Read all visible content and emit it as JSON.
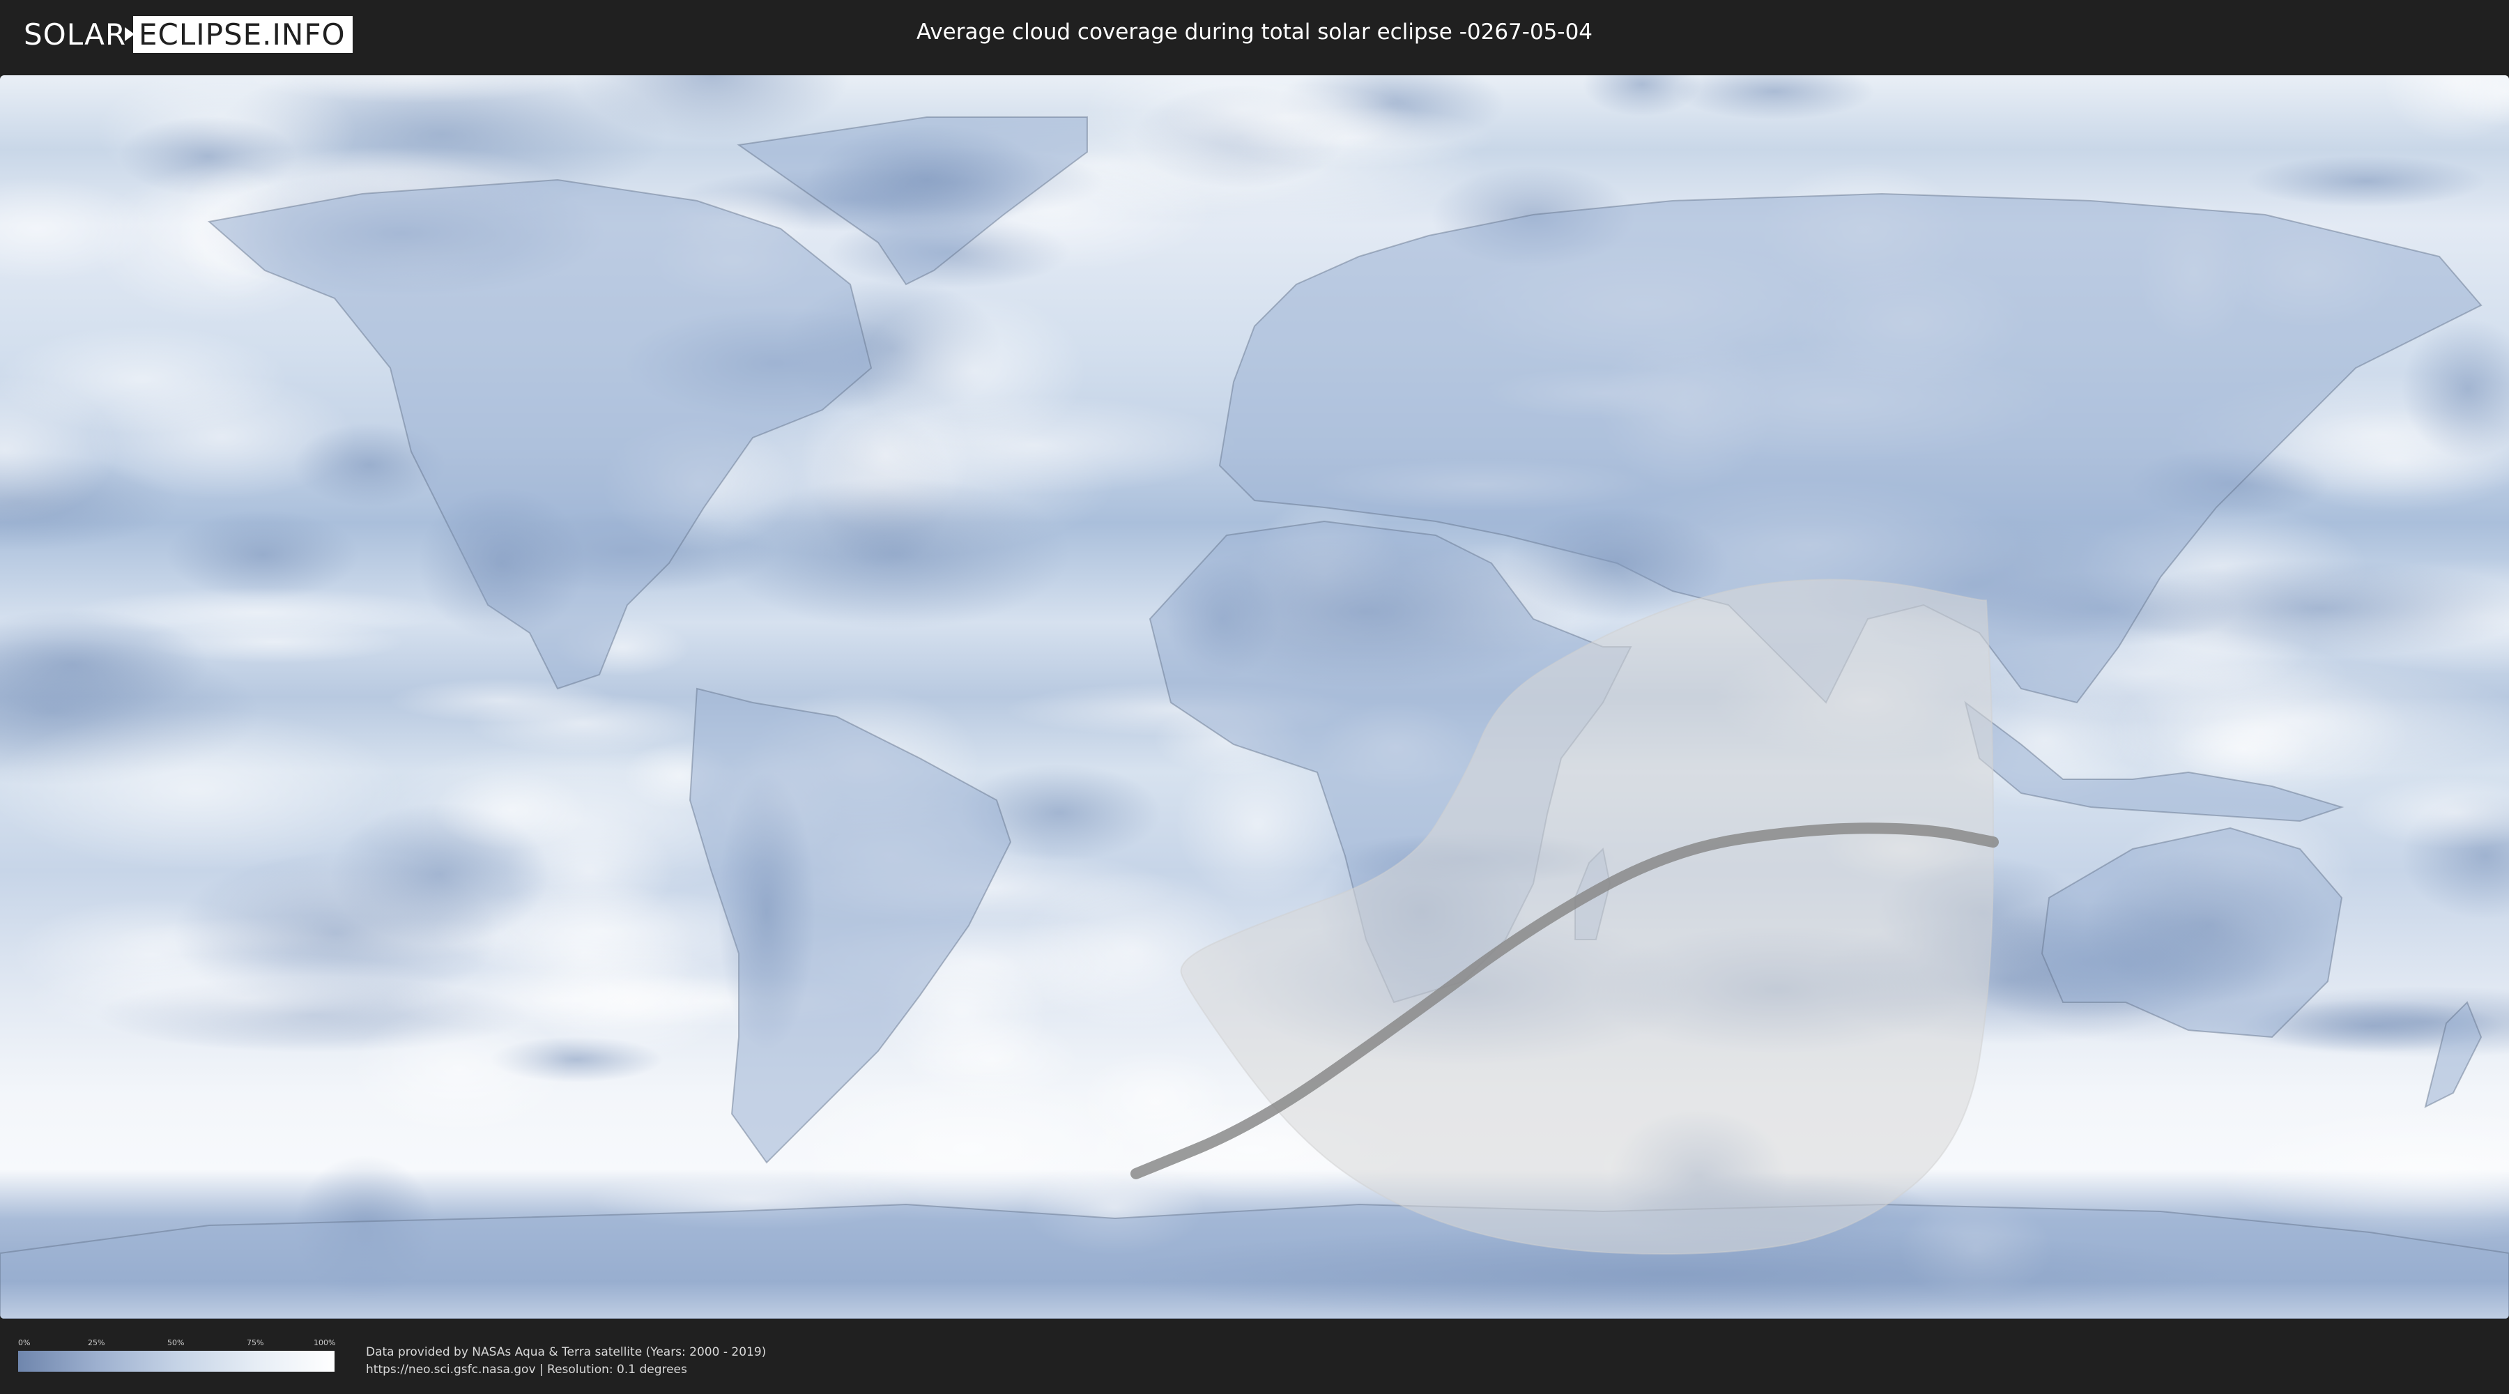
{
  "header": {
    "logo_left": "SOLAR",
    "logo_right": "ECLIPSE.INFO",
    "title": "Average cloud coverage during total solar eclipse -0267-05-04"
  },
  "legend": {
    "labels": [
      "0%",
      "25%",
      "50%",
      "75%",
      "100%"
    ],
    "gradient_colors": [
      "#6f86ad",
      "#9db0cf",
      "#c5d3e6",
      "#e6edf5",
      "#ffffff"
    ]
  },
  "credits": {
    "line1": "Data provided by NASAs Aqua & Terra satellite (Years: 2000 - 2019)",
    "line2": "https://neo.sci.gsfc.nasa.gov | Resolution: 0.1 degrees"
  },
  "map": {
    "projection": "equirectangular",
    "layers": [
      "cloud-coverage",
      "country-borders",
      "eclipse-penumbra-region",
      "totality-path"
    ],
    "colors": {
      "clear_sky": "#6d86b0",
      "cloudy": "#f4f7fb",
      "penumbra_overlay": "#d9d9d9",
      "totality_path": "#8a8a8a"
    },
    "totality_path": {
      "lon": [
        -17,
        0,
        20,
        40,
        60,
        80,
        96,
        106
      ],
      "lat": [
        -69,
        -62,
        -48,
        -33,
        -22,
        -19,
        -19,
        -21
      ]
    },
    "penumbra_boundary": {
      "lon": [
        105,
        106,
        106,
        102,
        85,
        65,
        40,
        20,
        5,
        -10,
        -11,
        0,
        22,
        30,
        35,
        48,
        62,
        75,
        90,
        104,
        105
      ],
      "lat": [
        14,
        -5,
        -40,
        -65,
        -78,
        -81,
        -80,
        -74,
        -63,
        -42,
        -38,
        -33,
        -25,
        -12,
        0,
        8,
        14,
        17,
        17,
        14,
        14
      ]
    }
  }
}
